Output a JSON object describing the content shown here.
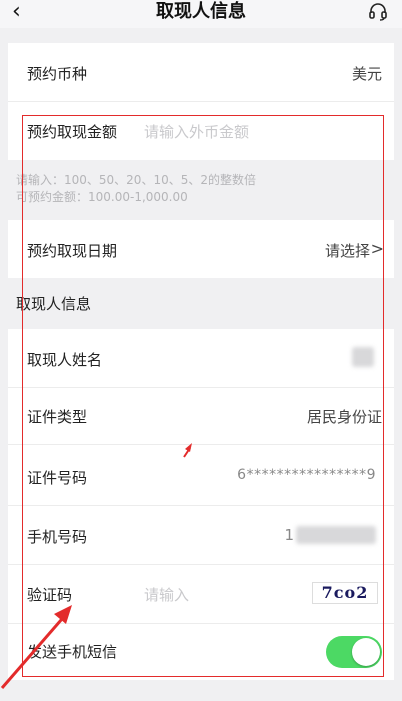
{
  "header": {
    "title": "取现人信息"
  },
  "currency": {
    "label": "预约币种",
    "value": "美元"
  },
  "amount": {
    "label": "预约取现金额",
    "placeholder": "请输入外币金额"
  },
  "amount_hint": {
    "line1": "请输入：100、50、20、10、5、2的整数倍",
    "line2": "可预约金额：100.00-1,000.00"
  },
  "date": {
    "label": "预约取现日期",
    "value": "请选择",
    "chevron": ">"
  },
  "section": {
    "title": "取现人信息"
  },
  "name": {
    "label": "取现人姓名"
  },
  "id_type": {
    "label": "证件类型",
    "value": "居民身份证"
  },
  "id_number": {
    "label": "证件号码",
    "value": "6****************9"
  },
  "phone": {
    "label": "手机号码",
    "value": "1"
  },
  "captcha": {
    "label": "验证码",
    "placeholder": "请输入",
    "image_text": "7ᴄo2"
  },
  "sms": {
    "label": "发送手机短信",
    "enabled": true
  },
  "colors": {
    "accent_green": "#4cd964",
    "annotation_red": "#e32b2b"
  }
}
